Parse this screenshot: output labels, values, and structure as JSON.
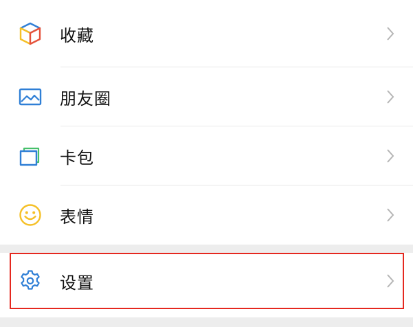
{
  "menu": {
    "items": [
      {
        "label": "收藏",
        "icon": "favorites-cube-icon"
      },
      {
        "label": "朋友圈",
        "icon": "moments-photo-icon"
      },
      {
        "label": "卡包",
        "icon": "card-wallet-icon"
      },
      {
        "label": "表情",
        "icon": "smiley-emoji-icon"
      }
    ],
    "settings": {
      "label": "设置",
      "icon": "gear-icon"
    }
  },
  "colors": {
    "highlight_border": "#e5281f",
    "icon_blue": "#2f7fd6",
    "icon_yellow": "#f5c027",
    "icon_red": "#e5523b",
    "icon_green": "#46c06a"
  }
}
